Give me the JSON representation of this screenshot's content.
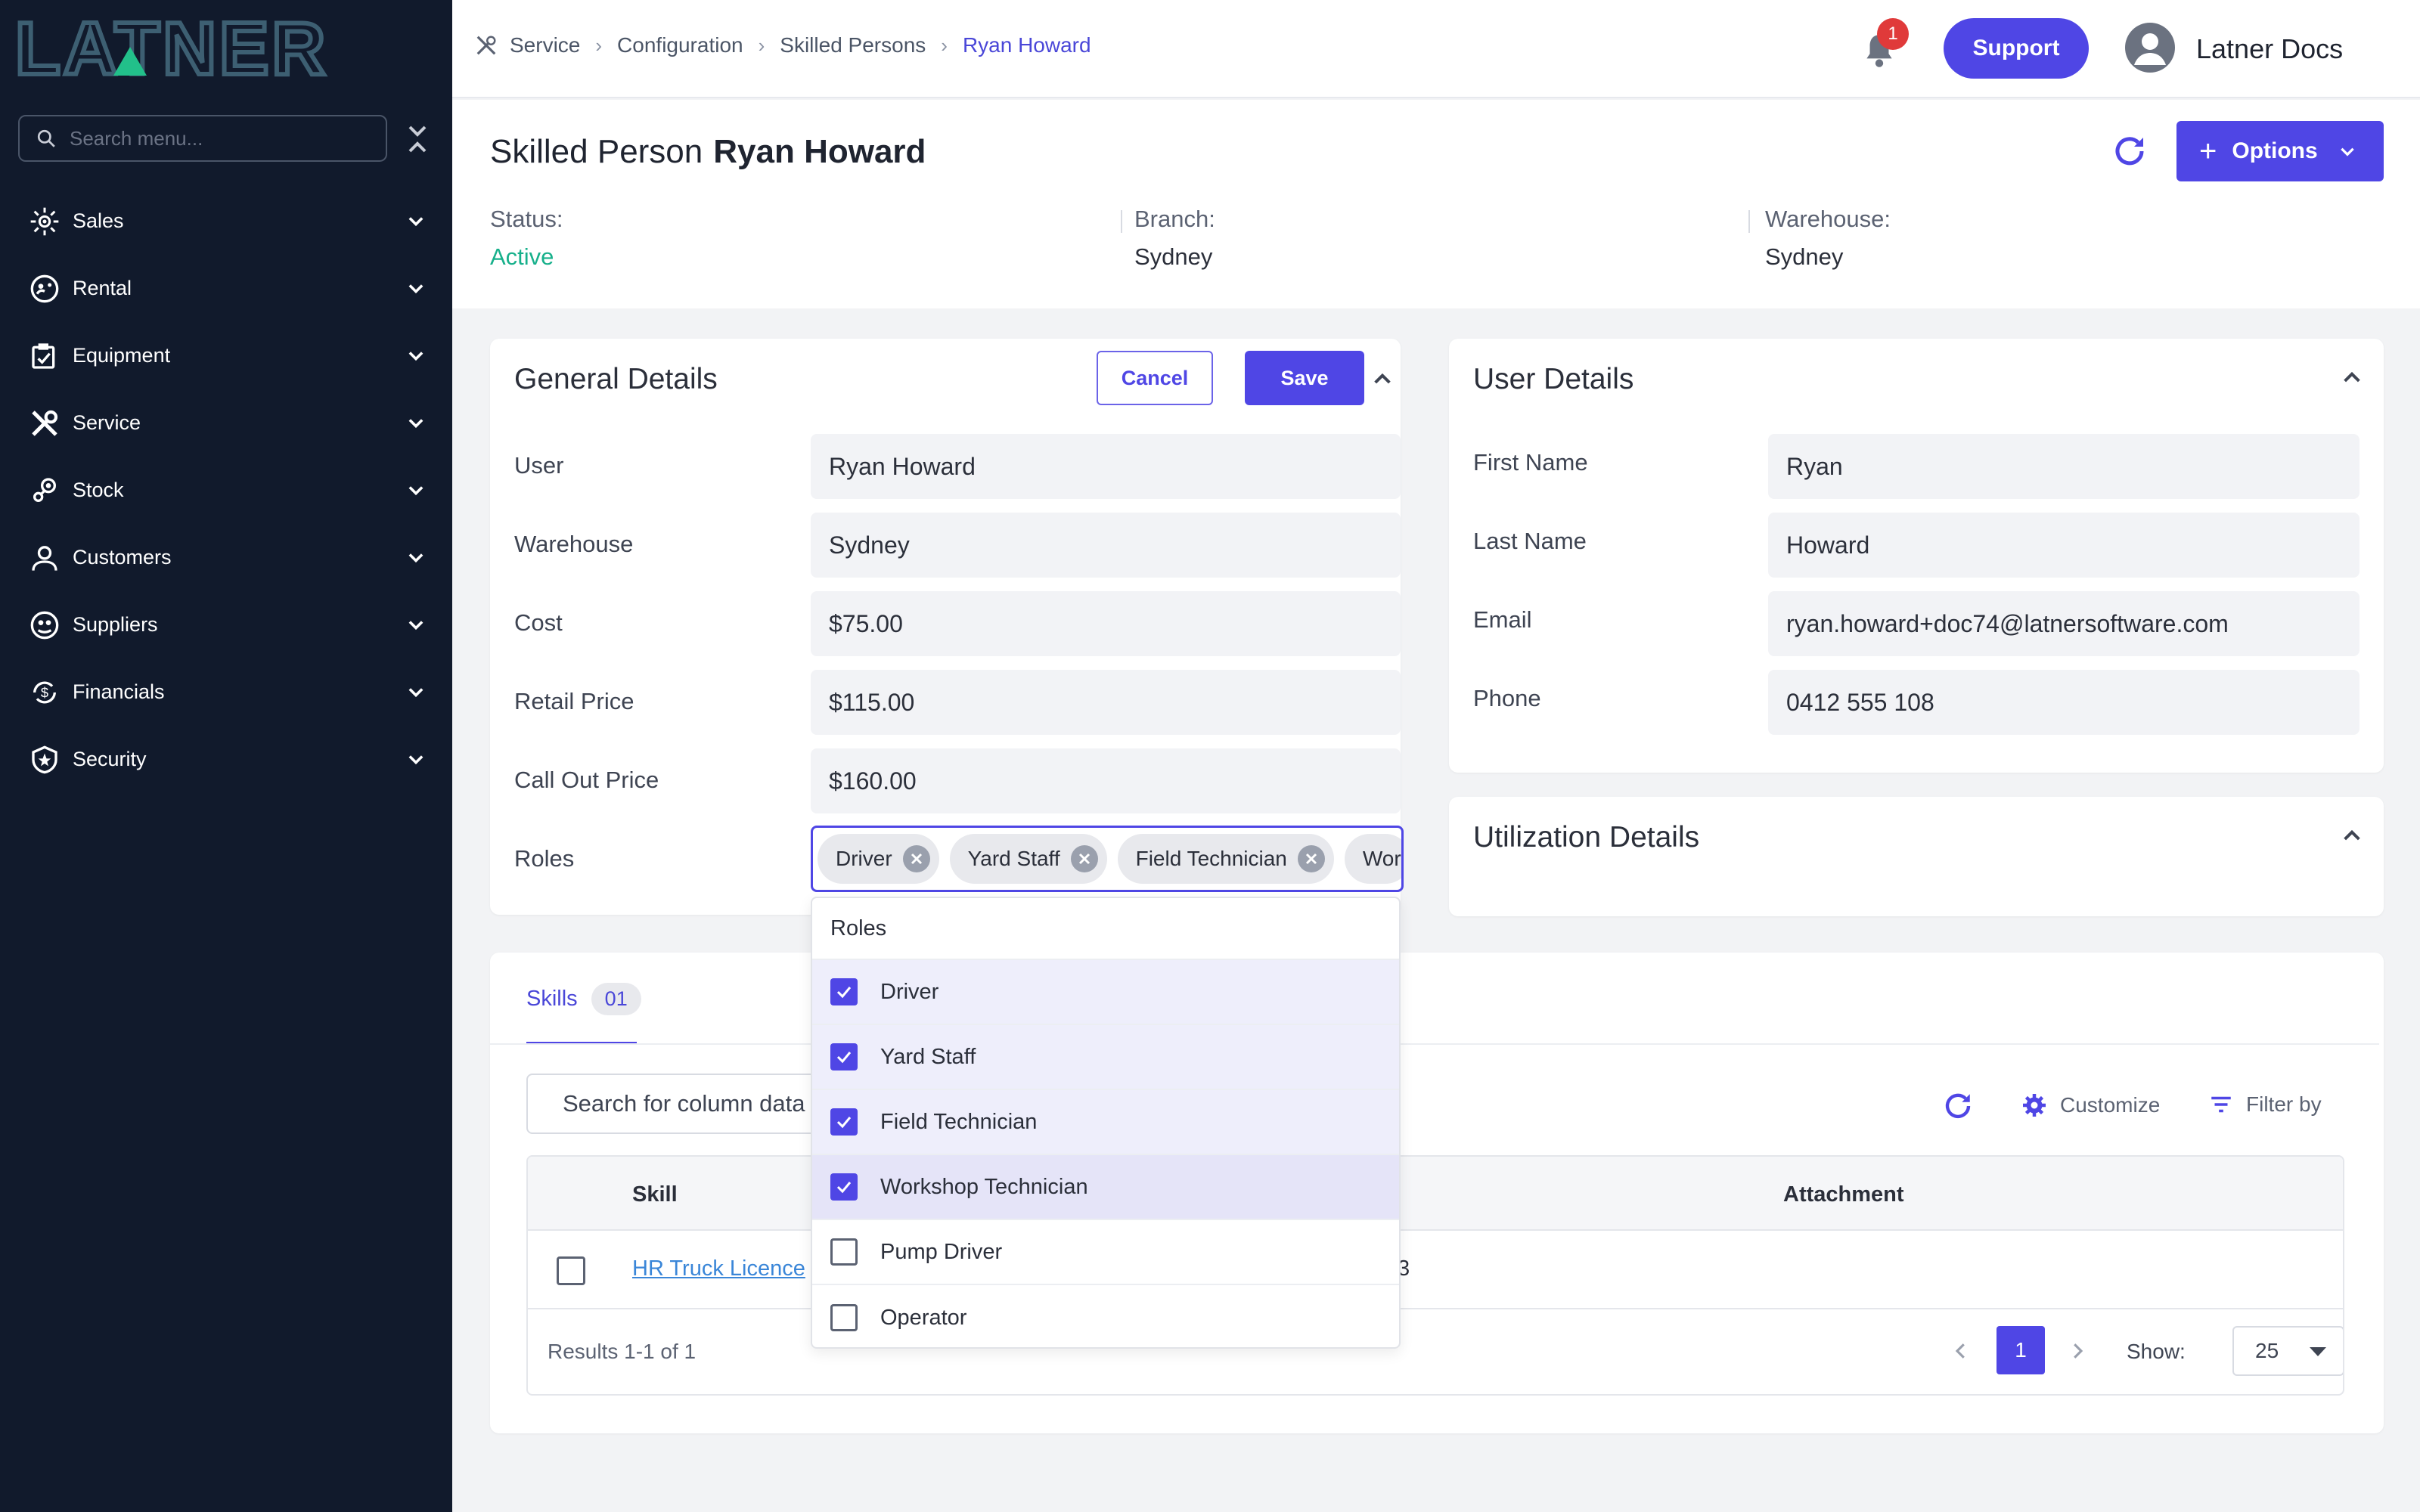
{
  "brand": {
    "logo_text": "LATNER",
    "accent": "#4f46e5",
    "sidebar_bg": "#111a2c"
  },
  "sidebar": {
    "search_placeholder": "Search menu...",
    "items": [
      {
        "label": "Sales",
        "icon": "sales-icon"
      },
      {
        "label": "Rental",
        "icon": "rental-icon"
      },
      {
        "label": "Equipment",
        "icon": "equipment-icon"
      },
      {
        "label": "Service",
        "icon": "service-icon"
      },
      {
        "label": "Stock",
        "icon": "stock-icon"
      },
      {
        "label": "Customers",
        "icon": "customers-icon"
      },
      {
        "label": "Suppliers",
        "icon": "suppliers-icon"
      },
      {
        "label": "Financials",
        "icon": "financials-icon"
      },
      {
        "label": "Security",
        "icon": "security-icon"
      }
    ]
  },
  "topbar": {
    "breadcrumbs": [
      "Service",
      "Configuration",
      "Skilled Persons",
      "Ryan Howard"
    ],
    "notification_count": "1",
    "support_label": "Support",
    "user_name": "Latner Docs"
  },
  "header": {
    "title_prefix": "Skilled Person",
    "title_name": "Ryan Howard",
    "options_label": "Options",
    "status_label": "Status:",
    "status_value": "Active",
    "branch_label": "Branch:",
    "branch_value": "Sydney",
    "warehouse_label": "Warehouse:",
    "warehouse_value": "Sydney"
  },
  "general": {
    "title": "General Details",
    "cancel_label": "Cancel",
    "save_label": "Save",
    "fields": [
      {
        "label": "User",
        "value": "Ryan Howard"
      },
      {
        "label": "Warehouse",
        "value": "Sydney"
      },
      {
        "label": "Cost",
        "value": "$75.00"
      },
      {
        "label": "Retail Price",
        "value": "$115.00"
      },
      {
        "label": "Call Out Price",
        "value": "$160.00"
      }
    ],
    "roles_label": "Roles",
    "role_chips": [
      "Driver",
      "Yard Staff",
      "Field Technician",
      "Wor"
    ]
  },
  "roles_dropdown": {
    "header": "Roles",
    "options": [
      {
        "label": "Driver",
        "checked": true
      },
      {
        "label": "Yard Staff",
        "checked": true
      },
      {
        "label": "Field Technician",
        "checked": true
      },
      {
        "label": "Workshop Technician",
        "checked": true
      },
      {
        "label": "Pump Driver",
        "checked": false
      },
      {
        "label": "Operator",
        "checked": false
      }
    ]
  },
  "user_details": {
    "title": "User Details",
    "fields": [
      {
        "label": "First Name",
        "value": "Ryan"
      },
      {
        "label": "Last Name",
        "value": "Howard"
      },
      {
        "label": "Email",
        "value": "ryan.howard+doc74@latnersoftware.com"
      },
      {
        "label": "Phone",
        "value": "0412 555 108"
      }
    ]
  },
  "utilization": {
    "title": "Utilization Details"
  },
  "skills": {
    "tab_label": "Skills",
    "tab_count": "01",
    "search_placeholder": "Search for column data",
    "customize_label": "Customize",
    "filter_label": "Filter by",
    "columns": {
      "skill": "Skill",
      "attachment": "Attachment"
    },
    "rows": [
      {
        "skill": "HR Truck Licence",
        "partial": "3"
      }
    ],
    "results_text": "Results 1-1 of 1",
    "current_page": "1",
    "show_label": "Show:",
    "page_size": "25"
  }
}
